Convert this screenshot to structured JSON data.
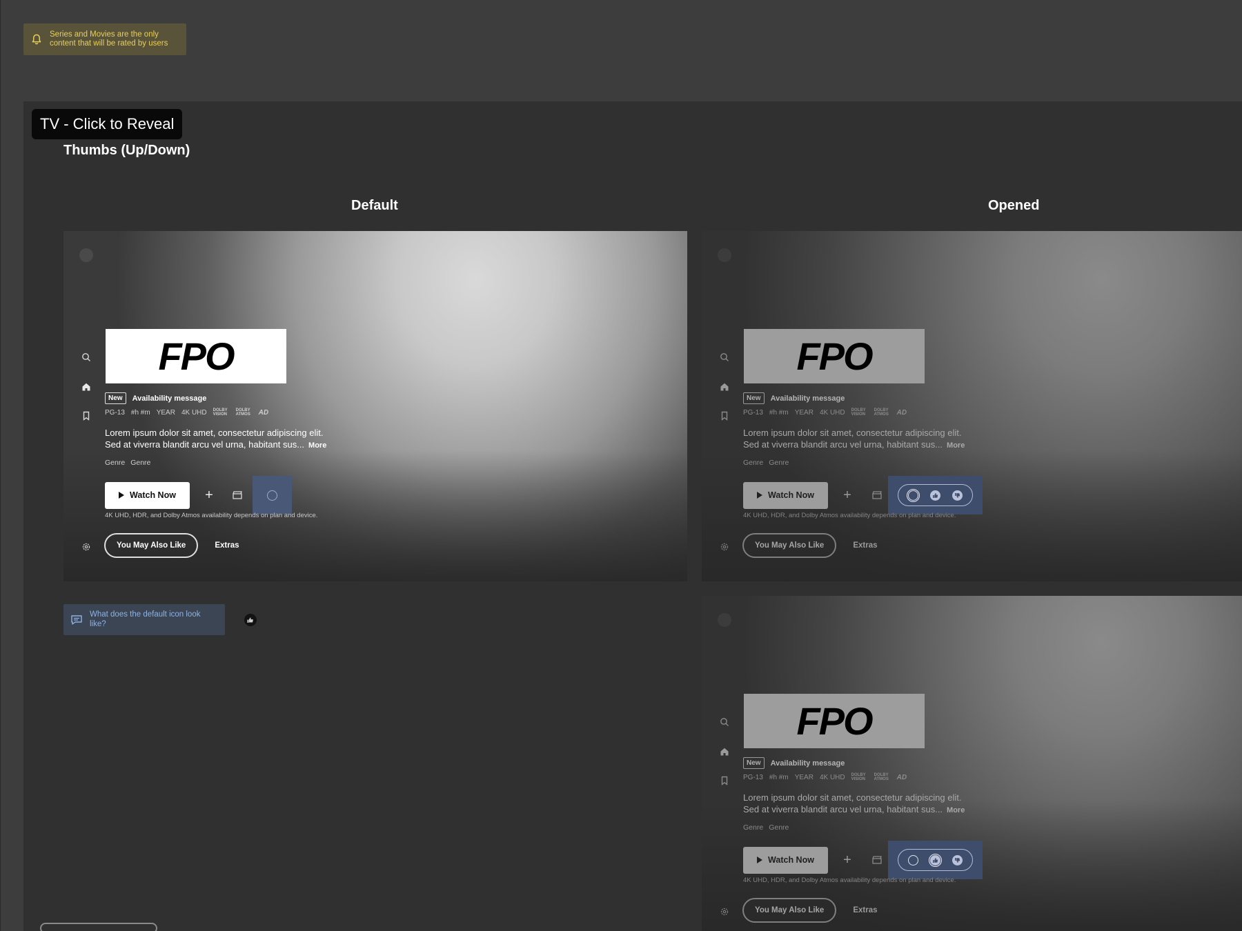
{
  "notice": {
    "line1": "Series and Movies are the only",
    "line2": "content that will be rated by users"
  },
  "frame": {
    "title": "TV - Click to Reveal",
    "subtitle": "Thumbs (Up/Down)"
  },
  "columns": {
    "default": "Default",
    "opened": "Opened"
  },
  "card": {
    "logo": "FPO",
    "badge": "New",
    "availability": "Availability message",
    "meta": {
      "rating": "PG-13",
      "duration": "#h #m",
      "year": "YEAR",
      "quality": "4K UHD",
      "dolby_line1": "DOLBY",
      "dolby_line2": "VISION",
      "atmos_line1": "DOLBY",
      "atmos_line2": "ATMOS",
      "ad": "AD"
    },
    "description_line1": "Lorem ipsum dolor sit amet, consectetur adipiscing elit.",
    "description_line2": "Sed at viverra blandit arcu vel urna, habitant sus...",
    "more": "More",
    "genre1": "Genre",
    "genre2": "Genre",
    "watch_now": "Watch Now",
    "plus": "+",
    "fine_print": "4K UHD, HDR, and Dolby Atmos availability depends on plan and device.",
    "you_may_also_like": "You May Also Like",
    "extras": "Extras"
  },
  "comment": {
    "text_line1": "What does the default icon look",
    "text_line2": "like?"
  },
  "icons": {
    "notice": "bell-icon",
    "search": "search-icon",
    "home": "home-icon",
    "watchlist": "bookmark-icon",
    "settings": "gear-icon",
    "trailer": "clapperboard-icon",
    "thumbs_up": "thumbs-up-icon",
    "thumbs_down": "thumbs-down-icon",
    "comment": "comment-icon"
  },
  "colors": {
    "notice_bg": "#59533a",
    "notice_text": "#e8cf5a",
    "rating_focus": "#4a5878",
    "comment_text": "#8fb2e3"
  }
}
